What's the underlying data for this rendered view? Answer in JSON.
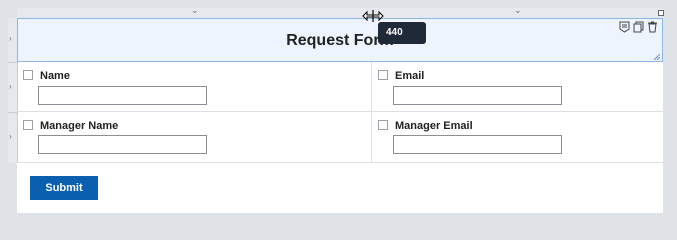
{
  "form": {
    "title": "Request Form",
    "width_tooltip": "440",
    "fields": [
      {
        "label": "Name",
        "value": ""
      },
      {
        "label": "Email",
        "value": ""
      },
      {
        "label": "Manager Name",
        "value": ""
      },
      {
        "label": "Manager Email",
        "value": ""
      }
    ],
    "submit_label": "Submit"
  },
  "icons": {
    "header_actions": [
      "properties-icon",
      "copy-icon",
      "delete-icon"
    ],
    "resize": "horizontal-resize-cursor-icon",
    "collapse": "chevron-icon"
  }
}
